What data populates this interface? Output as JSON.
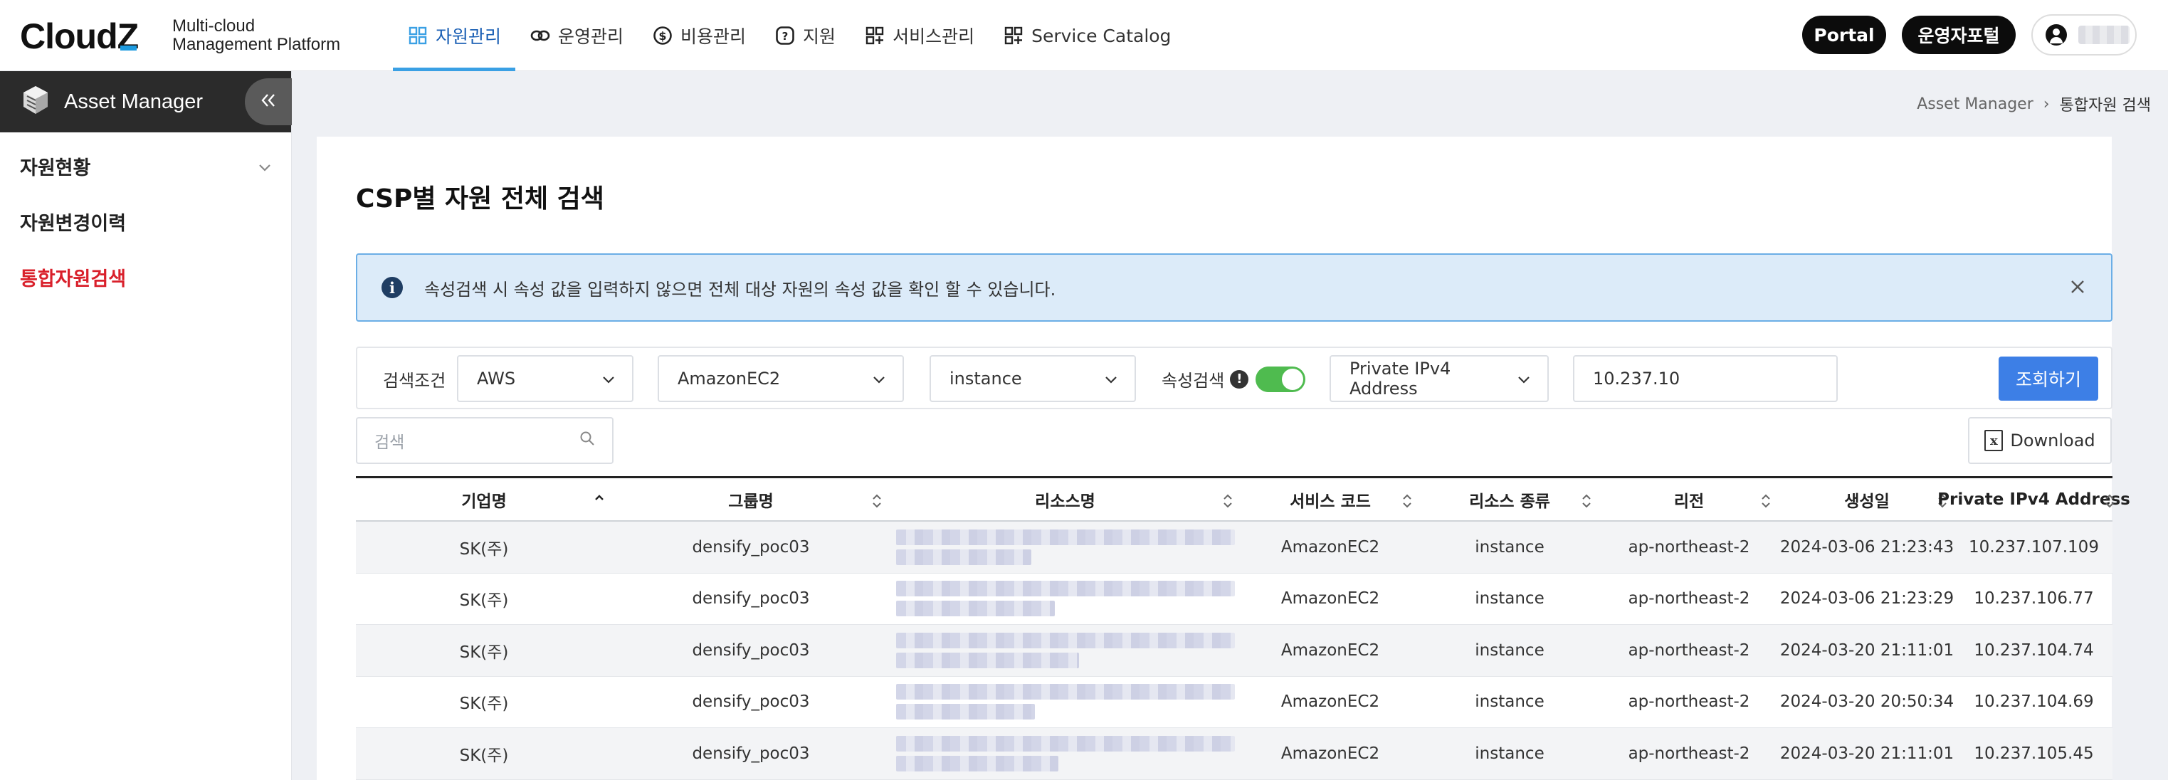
{
  "brand": {
    "logo_text": "Cloud",
    "logo_z": "Z",
    "subtitle_line1": "Multi-cloud",
    "subtitle_line2": "Management Platform"
  },
  "nav": {
    "items": [
      {
        "label": "자원관리",
        "icon": "grid-icon",
        "active": true
      },
      {
        "label": "운영관리",
        "icon": "link-icon",
        "active": false
      },
      {
        "label": "비용관리",
        "icon": "dollar-icon",
        "active": false
      },
      {
        "label": "지원",
        "icon": "question-icon",
        "active": false
      },
      {
        "label": "서비스관리",
        "icon": "apps-icon",
        "active": false
      },
      {
        "label": "Service Catalog",
        "icon": "catalog-icon",
        "active": false
      }
    ],
    "portal_label": "Portal",
    "ops_portal_label": "운영자포털"
  },
  "sidebar": {
    "title": "Asset Manager",
    "items": [
      {
        "label": "자원현황",
        "has_chevron": true,
        "active": false
      },
      {
        "label": "자원변경이력",
        "has_chevron": false,
        "active": false
      },
      {
        "label": "통합자원검색",
        "has_chevron": false,
        "active": true
      }
    ]
  },
  "breadcrumb": {
    "root": "Asset Manager",
    "separator": "›",
    "current": "통합자원 검색"
  },
  "page": {
    "title": "CSP별 자원 전체 검색"
  },
  "alert": {
    "text": "속성검색 시 속성 값을 입력하지 않으면 전체 대상 자원의 속성 값을 확인 할 수 있습니다."
  },
  "filter": {
    "label": "검색조건",
    "csp": "AWS",
    "service": "AmazonEC2",
    "resource_type": "instance",
    "attr_search_label": "속성검색",
    "attr_search_on": true,
    "attribute": "Private IPv4 Address",
    "value": "10.237.10",
    "submit_label": "조회하기"
  },
  "toolbar": {
    "search_placeholder": "검색",
    "download_label": "Download"
  },
  "table": {
    "columns": [
      "기업명",
      "그룹명",
      "리소스명",
      "서비스 코드",
      "리소스 종류",
      "리전",
      "생성일",
      "Private IPv4 Address"
    ],
    "rows": [
      {
        "company": "SK(주)",
        "group": "densify_poc03",
        "service_code": "AmazonEC2",
        "resource_type": "instance",
        "region": "ap-northeast-2",
        "created": "2024-03-06 21:23:43",
        "ip": "10.237.107.109"
      },
      {
        "company": "SK(주)",
        "group": "densify_poc03",
        "service_code": "AmazonEC2",
        "resource_type": "instance",
        "region": "ap-northeast-2",
        "created": "2024-03-06 21:23:29",
        "ip": "10.237.106.77"
      },
      {
        "company": "SK(주)",
        "group": "densify_poc03",
        "service_code": "AmazonEC2",
        "resource_type": "instance",
        "region": "ap-northeast-2",
        "created": "2024-03-20 21:11:01",
        "ip": "10.237.104.74"
      },
      {
        "company": "SK(주)",
        "group": "densify_poc03",
        "service_code": "AmazonEC2",
        "resource_type": "instance",
        "region": "ap-northeast-2",
        "created": "2024-03-20 20:50:34",
        "ip": "10.237.104.69"
      },
      {
        "company": "SK(주)",
        "group": "densify_poc03",
        "service_code": "AmazonEC2",
        "resource_type": "instance",
        "region": "ap-northeast-2",
        "created": "2024-03-20 21:11:01",
        "ip": "10.237.105.45"
      }
    ]
  },
  "colors": {
    "accent": "#3d7fe6",
    "active_nav": "#3aa0e4",
    "active_sidebar": "#d9202b",
    "toggle_on": "#4fbb4f"
  }
}
